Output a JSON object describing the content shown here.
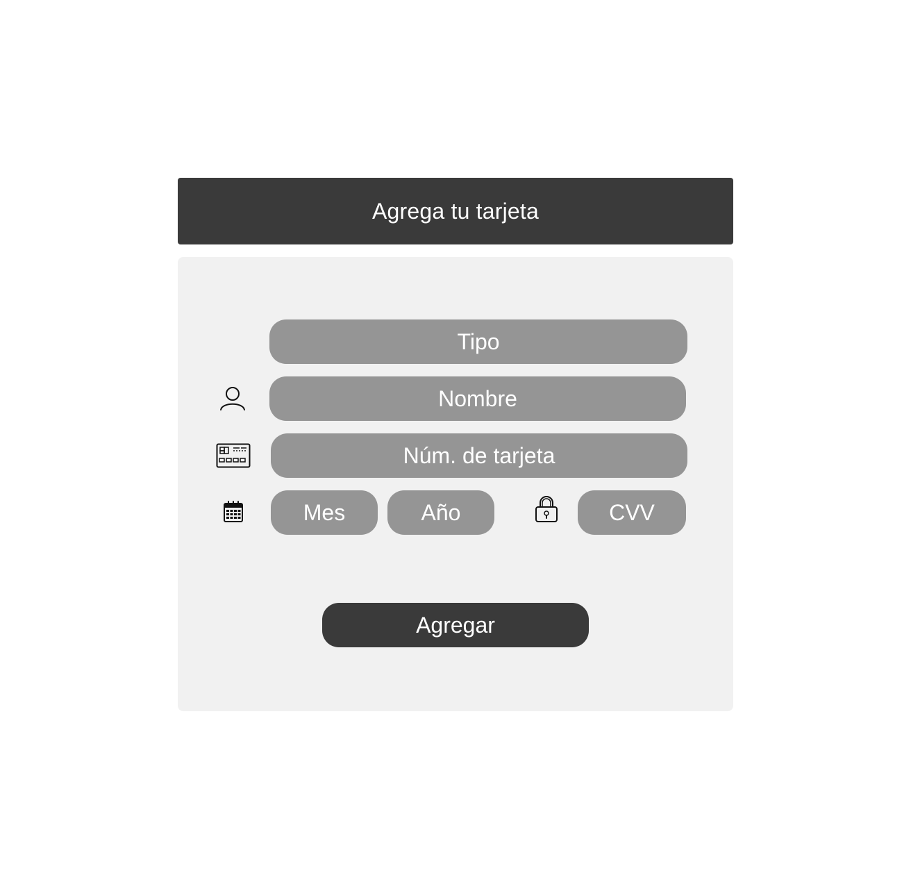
{
  "header": {
    "title": "Agrega tu tarjeta"
  },
  "form": {
    "tipo_label": "Tipo",
    "nombre_label": "Nombre",
    "numero_label": "Núm. de tarjeta",
    "mes_label": "Mes",
    "anio_label": "Año",
    "cvv_label": "CVV",
    "submit_label": "Agregar"
  },
  "icons": {
    "nombre": "user-icon",
    "numero": "credit-card-icon",
    "fecha": "calendar-icon",
    "cvv": "lock-icon"
  },
  "colors": {
    "header_bg": "#3a3a3a",
    "panel_bg": "#f1f1f1",
    "field_bg": "#959595",
    "button_bg": "#3a3a3a",
    "text_light": "#ffffff"
  }
}
